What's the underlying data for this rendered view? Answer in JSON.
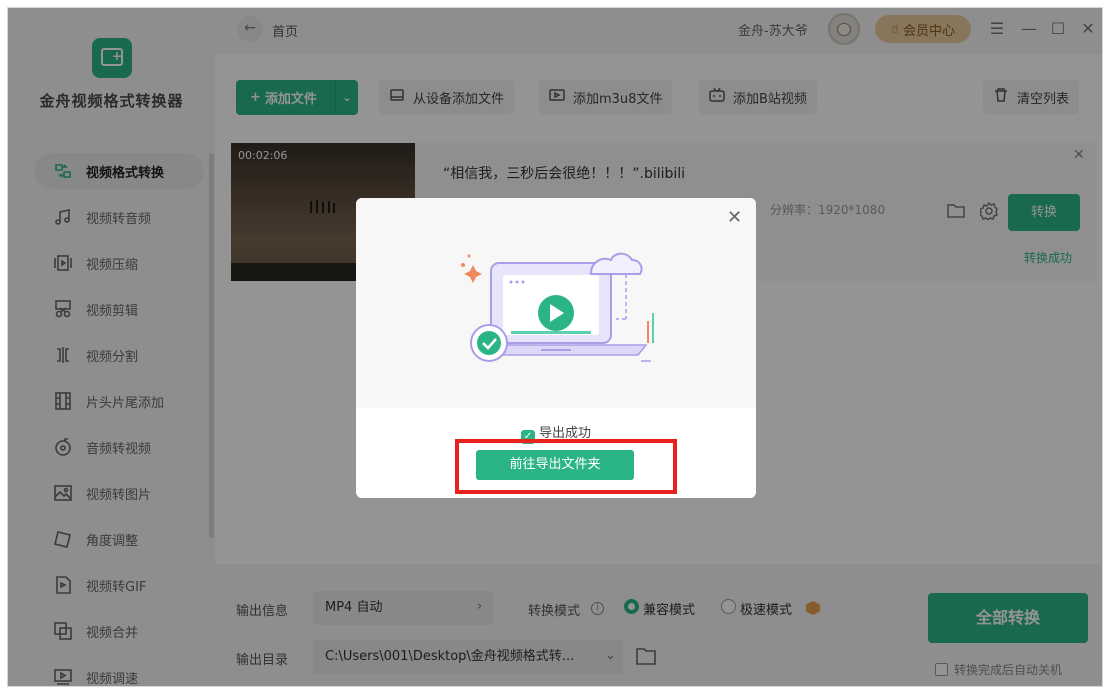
{
  "app": {
    "name": "金舟视频格式转换器",
    "logo_icon": "video-convert-logo-icon",
    "accent": "#2bb586"
  },
  "sidebar": {
    "items": [
      {
        "label": "视频格式转换",
        "icon": "format-convert-icon",
        "active": true
      },
      {
        "label": "视频转音频",
        "icon": "music-note-icon",
        "active": false
      },
      {
        "label": "视频压缩",
        "icon": "compress-icon",
        "active": false
      },
      {
        "label": "视频剪辑",
        "icon": "scissors-icon",
        "active": false
      },
      {
        "label": "视频分割",
        "icon": "split-icon",
        "active": false
      },
      {
        "label": "片头片尾添加",
        "icon": "film-strip-icon",
        "active": false
      },
      {
        "label": "音频转视频",
        "icon": "audio-disc-icon",
        "active": false
      },
      {
        "label": "视频转图片",
        "icon": "image-icon",
        "active": false
      },
      {
        "label": "角度调整",
        "icon": "rotate-icon",
        "active": false
      },
      {
        "label": "视频转GIF",
        "icon": "gif-icon",
        "active": false
      },
      {
        "label": "视频合并",
        "icon": "merge-icon",
        "active": false
      },
      {
        "label": "视频调速",
        "icon": "speed-icon",
        "active": false
      }
    ]
  },
  "topbar": {
    "breadcrumb": "首页",
    "username": "金舟-苏大爷",
    "vip_label": "会员中心",
    "window_controls": [
      "menu-icon",
      "minimize-icon",
      "maximize-icon",
      "close-icon"
    ]
  },
  "toolbar": {
    "add_file": "添加文件",
    "add_from_device": "从设备添加文件",
    "add_m3u8": "添加m3u8文件",
    "add_bilibili": "添加B站视频",
    "clear_list": "清空列表"
  },
  "file": {
    "duration": "00:02:06",
    "title": "“相信我，三秒后会很绝！！！”.bilibili",
    "resolution": "分辨率：1920*1080",
    "convert_label": "转换",
    "status": "转换成功"
  },
  "bottom": {
    "output_info_label": "输出信息",
    "output_format": "MP4 自动",
    "mode_label": "转换模式",
    "mode_compatible": "兼容模式",
    "mode_fast": "极速模式",
    "output_dir_label": "输出目录",
    "output_dir": "C:\\Users\\001\\Desktop\\金舟视频格式转...",
    "convert_all": "全部转换",
    "auto_shutdown": "转换完成后自动关机"
  },
  "modal": {
    "success_text": "导出成功",
    "open_folder": "前往导出文件夹",
    "illustration": "laptop-play-cloud-illustration",
    "highlight_color": "#e8201e"
  }
}
